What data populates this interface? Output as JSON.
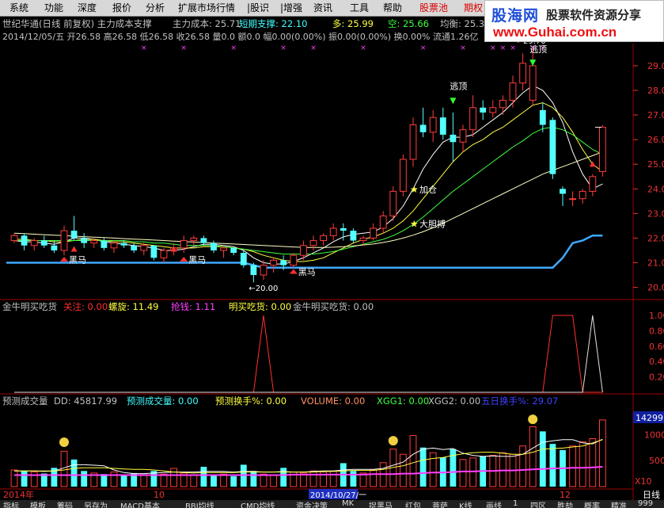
{
  "menu": {
    "items": [
      "系统",
      "功能",
      "深度",
      "报价",
      "分析",
      "扩展市场行情",
      "|股识",
      "|增强",
      "资讯",
      "工具",
      "帮助",
      "股票池",
      "期权"
    ],
    "red_items": [
      "股票池",
      "期权"
    ]
  },
  "brand": {
    "logo": "股海网",
    "slogan": "股票软件资源分享",
    "url": "www.Guhai.com.cn"
  },
  "header": {
    "title": "世纪华通(日线 前复权) 主力成本支撑",
    "cost_label": "主力成本: 25.71",
    "short_support": "短期支撑: 22.10",
    "long": "多: 25.99",
    "short": "空: 25.66",
    "avg": "均衡: 25.35",
    "ohlc": "2014/12/05/五 开26.58 高26.58 低26.58 收26.58 量0.0 额0.0 幅0.00(0.00%) 振0.00(0.00%) 换0.00% 流通1.26亿"
  },
  "annotations": {
    "top_price": "29.70",
    "escape1": "逃顶",
    "escape2": "逃顶",
    "add_position": "加仓",
    "bold_buy": "大胆搏",
    "dark_horse": "黑马",
    "low_price": "20.00"
  },
  "ind1": {
    "name": "金牛明买吃货",
    "items": [
      {
        "t": "关注: 0.00",
        "c": "#ff3030"
      },
      {
        "t": "螺旋: 11.49",
        "c": "#ffff40"
      },
      {
        "t": "抢钱: 1.11",
        "c": "#ff40ff"
      },
      {
        "t": "明买吃货: 0.00",
        "c": "#ffff40"
      },
      {
        "t": "金牛明买吃货: 0.00",
        "c": "#c0c0c0"
      }
    ],
    "axis": [
      "1.00",
      "0.80",
      "0.60",
      "0.40",
      "0.20"
    ]
  },
  "ind2": {
    "name": "预测成交量",
    "items": [
      {
        "t": "DD: 45817.99",
        "c": "#c0c0c0"
      },
      {
        "t": "预测成交量: 0.00",
        "c": "#40ffff"
      },
      {
        "t": "预测换手%: 0.00",
        "c": "#ffff40"
      },
      {
        "t": "VOLUME: 0.00",
        "c": "#ff9060"
      },
      {
        "t": "XGG1: 0.00",
        "c": "#40ff40"
      },
      {
        "t": "XGG2: 0.00",
        "c": "#c0c0c0"
      },
      {
        "t": "五日换手%: 29.07",
        "c": "#4040ff"
      }
    ],
    "axis": [
      "14299",
      "10000",
      "5000"
    ],
    "unit": "X10"
  },
  "date_axis": {
    "year": "2014年",
    "m1": "10",
    "cursor": "2014/10/27/一",
    "m2": "12",
    "period": "日线"
  },
  "bottom_tabs": [
    "指标",
    "模板",
    "筹码",
    "另存为",
    "MACD基本",
    "BBI均线",
    "CMD均线",
    "资金决策",
    "MK",
    "捉黑马",
    "红包",
    "菩萨",
    "K线",
    "画线",
    "1",
    "四区",
    "胜劫",
    "概率",
    "精准",
    "999",
    "???"
  ],
  "chart_data": {
    "type": "candlestick",
    "ylim": [
      19.6,
      29.9
    ],
    "yticks": [
      "29.00",
      "28.00",
      "27.00",
      "26.00",
      "25.00",
      "24.00",
      "23.00",
      "22.00",
      "21.00",
      "20.00"
    ],
    "candles": [
      [
        21.9,
        22.2,
        21.8,
        22.1
      ],
      [
        22.1,
        22.2,
        21.5,
        21.7
      ],
      [
        21.7,
        22.0,
        21.5,
        21.9
      ],
      [
        21.9,
        22.1,
        21.6,
        21.7
      ],
      [
        21.7,
        21.9,
        21.4,
        21.5
      ],
      [
        21.5,
        22.5,
        21.3,
        22.3
      ],
      [
        22.3,
        22.9,
        21.9,
        22.0
      ],
      [
        22.0,
        22.2,
        21.6,
        21.8
      ],
      [
        21.8,
        22.0,
        21.6,
        21.9
      ],
      [
        21.9,
        22.0,
        21.5,
        21.6
      ],
      [
        21.6,
        21.9,
        21.4,
        21.8
      ],
      [
        21.8,
        21.9,
        21.6,
        21.7
      ],
      [
        21.7,
        21.8,
        21.4,
        21.5
      ],
      [
        21.5,
        21.8,
        21.3,
        21.7
      ],
      [
        21.7,
        21.7,
        21.1,
        21.2
      ],
      [
        21.2,
        21.6,
        21.0,
        21.5
      ],
      [
        21.5,
        21.8,
        21.3,
        21.6
      ],
      [
        21.6,
        22.1,
        21.4,
        21.9
      ],
      [
        21.9,
        22.1,
        21.7,
        22.0
      ],
      [
        22.0,
        22.1,
        21.7,
        21.8
      ],
      [
        21.8,
        21.9,
        21.4,
        21.5
      ],
      [
        21.5,
        21.7,
        21.2,
        21.6
      ],
      [
        21.6,
        21.6,
        21.3,
        21.4
      ],
      [
        21.4,
        21.5,
        20.8,
        20.9
      ],
      [
        20.9,
        21.0,
        20.2,
        20.5
      ],
      [
        20.5,
        21.1,
        20.3,
        20.9
      ],
      [
        20.9,
        21.2,
        20.6,
        21.1
      ],
      [
        21.1,
        21.3,
        20.7,
        20.9
      ],
      [
        20.9,
        21.4,
        20.8,
        21.3
      ],
      [
        21.3,
        21.9,
        21.1,
        21.7
      ],
      [
        21.7,
        22.1,
        21.5,
        21.9
      ],
      [
        21.9,
        22.2,
        21.7,
        22.1
      ],
      [
        22.1,
        22.6,
        21.9,
        22.4
      ],
      [
        22.4,
        22.6,
        21.9,
        22.3
      ],
      [
        22.3,
        22.4,
        21.8,
        21.9
      ],
      [
        21.9,
        22.1,
        21.7,
        22.0
      ],
      [
        22.0,
        22.6,
        21.9,
        22.4
      ],
      [
        22.4,
        23.1,
        22.2,
        22.9
      ],
      [
        22.9,
        24.1,
        22.7,
        23.9
      ],
      [
        23.9,
        25.4,
        23.7,
        25.2
      ],
      [
        25.2,
        26.9,
        24.9,
        26.6
      ],
      [
        26.6,
        27.3,
        26.1,
        26.3
      ],
      [
        26.3,
        27.2,
        25.9,
        26.9
      ],
      [
        26.9,
        27.3,
        26.0,
        26.2
      ],
      [
        26.2,
        27.1,
        25.1,
        25.9
      ],
      [
        25.9,
        26.6,
        25.5,
        26.4
      ],
      [
        26.4,
        27.8,
        26.1,
        27.3
      ],
      [
        27.3,
        27.6,
        26.8,
        27.1
      ],
      [
        27.1,
        27.6,
        26.9,
        27.3
      ],
      [
        27.3,
        27.8,
        27.0,
        27.6
      ],
      [
        27.6,
        28.6,
        27.3,
        28.3
      ],
      [
        28.3,
        29.5,
        28.0,
        29.1
      ],
      [
        27.6,
        29.7,
        27.4,
        29.0
      ],
      [
        27.2,
        27.5,
        26.3,
        26.6
      ],
      [
        26.8,
        26.9,
        24.4,
        24.6
      ],
      [
        24.0,
        24.1,
        23.3,
        23.8
      ],
      [
        23.6,
        23.9,
        23.3,
        23.6
      ],
      [
        23.6,
        24.0,
        23.4,
        23.9
      ],
      [
        23.9,
        24.6,
        23.7,
        24.5
      ],
      [
        24.7,
        26.6,
        24.5,
        26.5
      ]
    ],
    "ma_lines": [
      {
        "name": "ma5",
        "color": "#ffffff",
        "values": [
          21.9,
          21.85,
          21.85,
          21.8,
          21.75,
          21.85,
          22.0,
          22.0,
          21.95,
          21.85,
          21.8,
          21.75,
          21.7,
          21.65,
          21.6,
          21.5,
          21.5,
          21.55,
          21.65,
          21.75,
          21.75,
          21.7,
          21.65,
          21.5,
          21.2,
          21.0,
          20.95,
          20.95,
          21.05,
          21.2,
          21.4,
          21.6,
          21.85,
          22.05,
          22.15,
          22.2,
          22.25,
          22.45,
          22.8,
          23.3,
          24.0,
          24.8,
          25.4,
          25.9,
          26.1,
          26.1,
          26.2,
          26.5,
          26.8,
          27.1,
          27.5,
          27.9,
          28.2,
          28.0,
          27.5,
          26.7,
          25.5,
          24.6,
          24.0,
          24.2
        ]
      },
      {
        "name": "ma10",
        "color": "#ffff40",
        "values": [
          21.95,
          21.95,
          21.9,
          21.9,
          21.85,
          21.85,
          21.9,
          21.95,
          21.95,
          21.9,
          21.85,
          21.85,
          21.8,
          21.75,
          21.7,
          21.65,
          21.6,
          21.6,
          21.6,
          21.65,
          21.65,
          21.65,
          21.6,
          21.55,
          21.45,
          21.3,
          21.2,
          21.1,
          21.05,
          21.05,
          21.1,
          21.2,
          21.4,
          21.6,
          21.8,
          21.95,
          22.05,
          22.2,
          22.4,
          22.7,
          23.1,
          23.6,
          24.1,
          24.6,
          25.1,
          25.5,
          25.8,
          26.0,
          26.3,
          26.5,
          26.8,
          27.1,
          27.4,
          27.5,
          27.3,
          26.9,
          26.3,
          25.6,
          25.0,
          24.7
        ]
      },
      {
        "name": "ma20",
        "color": "#40ff40",
        "values": [
          21.9,
          21.9,
          21.9,
          21.9,
          21.9,
          21.9,
          21.9,
          21.9,
          21.9,
          21.9,
          21.9,
          21.9,
          21.85,
          21.85,
          21.8,
          21.8,
          21.75,
          21.7,
          21.7,
          21.7,
          21.7,
          21.65,
          21.6,
          21.55,
          21.5,
          21.45,
          21.4,
          21.35,
          21.35,
          21.35,
          21.35,
          21.4,
          21.45,
          21.55,
          21.65,
          21.75,
          21.85,
          21.95,
          22.1,
          22.3,
          22.55,
          22.85,
          23.2,
          23.55,
          23.9,
          24.2,
          24.5,
          24.8,
          25.1,
          25.4,
          25.7,
          25.95,
          26.25,
          26.45,
          26.5,
          26.4,
          26.2,
          25.9,
          25.6,
          25.4
        ]
      },
      {
        "name": "ma60",
        "color": "#ffffc0",
        "values": [
          22.2,
          22.18,
          22.16,
          22.14,
          22.12,
          22.1,
          22.08,
          22.06,
          22.04,
          22.02,
          22.0,
          21.98,
          21.96,
          21.94,
          21.92,
          21.9,
          21.88,
          21.86,
          21.84,
          21.82,
          21.8,
          21.78,
          21.76,
          21.74,
          21.72,
          21.7,
          21.68,
          21.66,
          21.64,
          21.62,
          21.62,
          21.62,
          21.63,
          21.65,
          21.68,
          21.72,
          21.76,
          21.82,
          21.9,
          22.0,
          22.12,
          22.26,
          22.42,
          22.6,
          22.8,
          23.0,
          23.2,
          23.4,
          23.6,
          23.8,
          24.0,
          24.2,
          24.4,
          24.6,
          24.75,
          24.9,
          25.05,
          25.2,
          25.35,
          25.5
        ]
      }
    ],
    "support_line": {
      "color": "#40a8ff",
      "values": [
        21.0,
        21.0,
        21.0,
        21.0,
        21.0,
        21.0,
        21.0,
        21.0,
        21.0,
        21.0,
        21.0,
        21.0,
        21.0,
        21.0,
        21.0,
        21.0,
        21.0,
        21.0,
        21.0,
        21.0,
        21.0,
        21.0,
        21.0,
        21.0,
        20.9,
        20.8,
        20.8,
        20.8,
        20.8,
        20.8,
        20.8,
        20.8,
        20.8,
        20.8,
        20.8,
        20.8,
        20.8,
        20.8,
        20.8,
        20.8,
        20.8,
        20.8,
        20.8,
        20.8,
        20.8,
        20.8,
        20.8,
        20.8,
        20.8,
        20.8,
        20.8,
        20.8,
        20.8,
        20.8,
        20.8,
        21.2,
        21.8,
        21.9,
        22.1,
        22.1
      ]
    },
    "ind1_series": [
      {
        "name": "关注",
        "color": "#ff3030",
        "values": [
          0,
          0,
          0,
          0,
          0,
          0,
          0,
          0,
          0,
          0,
          0,
          0,
          0,
          0,
          0,
          0,
          0,
          0,
          0,
          0,
          0,
          0,
          0,
          0,
          0,
          1,
          0,
          0,
          0,
          0,
          0,
          0,
          0,
          0,
          0,
          0,
          0,
          0,
          0,
          0,
          0,
          0,
          0,
          0,
          0,
          0,
          0,
          0,
          0,
          0,
          0,
          0,
          0,
          0,
          1,
          1,
          1,
          0,
          0,
          0
        ]
      },
      {
        "name": "金牛明买吃货",
        "color": "#e0e0e0",
        "values": [
          0,
          0,
          0,
          0,
          0,
          0,
          0,
          0,
          0,
          0,
          0,
          0,
          0,
          0,
          0,
          0,
          0,
          0,
          0,
          0,
          0,
          0,
          0,
          0,
          0,
          0,
          0,
          0,
          0,
          0,
          0,
          0,
          0,
          0,
          0,
          0,
          0,
          0,
          0,
          0,
          0,
          0,
          0,
          0,
          0,
          0,
          0,
          0,
          0,
          0,
          0,
          0,
          0,
          0,
          0,
          0,
          0,
          0,
          1,
          0
        ]
      }
    ],
    "volume": [
      3.2,
      3.0,
      2.8,
      2.5,
      3.6,
      6.8,
      5.2,
      3.0,
      2.6,
      2.4,
      2.8,
      2.2,
      2.6,
      2.3,
      3.0,
      2.4,
      3.5,
      2.6,
      2.2,
      3.8,
      2.1,
      2.4,
      2.0,
      4.2,
      3.0,
      2.4,
      2.2,
      3.6,
      2.8,
      2.6,
      3.0,
      2.8,
      3.0,
      4.5,
      3.0,
      2.6,
      3.2,
      4.6,
      7.2,
      6.2,
      9.8,
      7.5,
      6.5,
      5.6,
      7.2,
      5.2,
      5.5,
      5.8,
      6.0,
      6.5,
      6.2,
      7.8,
      11.5,
      10.6,
      8.2,
      7.0,
      7.8,
      8.6,
      9.2,
      12.8
    ],
    "volume_ma": [
      {
        "name": "ma5",
        "color": "#ffffff",
        "values": [
          3.0,
          3.0,
          3.0,
          2.9,
          3.0,
          3.6,
          4.2,
          4.2,
          4.1,
          4.0,
          3.2,
          2.7,
          2.5,
          2.5,
          2.6,
          2.7,
          2.8,
          2.8,
          2.8,
          2.9,
          2.9,
          2.9,
          2.8,
          2.9,
          2.9,
          2.8,
          2.8,
          2.9,
          2.8,
          2.8,
          2.9,
          3.0,
          3.0,
          3.2,
          3.3,
          3.3,
          3.3,
          3.5,
          4.1,
          4.7,
          6.2,
          7.2,
          7.4,
          7.1,
          7.3,
          6.4,
          6.0,
          5.8,
          5.9,
          5.8,
          5.8,
          6.2,
          7.4,
          8.5,
          8.8,
          9.0,
          9.0,
          8.4,
          8.2,
          9.1
        ]
      },
      {
        "name": "ma10",
        "color": "#ffff40",
        "values": [
          3.0,
          3.0,
          3.0,
          3.0,
          3.0,
          3.2,
          3.5,
          3.6,
          3.6,
          3.6,
          3.5,
          3.4,
          3.3,
          3.3,
          3.2,
          3.0,
          2.8,
          2.7,
          2.6,
          2.7,
          2.7,
          2.7,
          2.7,
          2.8,
          2.8,
          2.8,
          2.8,
          2.8,
          2.8,
          2.8,
          2.8,
          2.9,
          2.9,
          3.0,
          3.1,
          3.1,
          3.1,
          3.3,
          3.7,
          4.0,
          4.6,
          5.1,
          5.4,
          5.6,
          6.0,
          6.3,
          6.5,
          6.6,
          6.6,
          6.4,
          6.2,
          6.2,
          6.6,
          7.2,
          7.3,
          7.4,
          7.6,
          7.8,
          8.4,
          9.0
        ]
      },
      {
        "name": "base",
        "color": "#ff40ff",
        "values": [
          2.2,
          2.2,
          2.2,
          2.2,
          2.2,
          2.2,
          2.2,
          2.2,
          2.2,
          2.2,
          2.2,
          2.2,
          2.2,
          2.2,
          2.2,
          2.2,
          2.2,
          2.2,
          2.2,
          2.2,
          2.2,
          2.2,
          2.2,
          2.2,
          2.2,
          2.2,
          2.2,
          2.2,
          2.3,
          2.3,
          2.3,
          2.3,
          2.3,
          2.3,
          2.3,
          2.3,
          2.4,
          2.4,
          2.4,
          2.5,
          2.5,
          2.6,
          2.7,
          2.7,
          2.8,
          2.9,
          2.9,
          3.0,
          3.0,
          3.1,
          3.1,
          3.2,
          3.3,
          3.4,
          3.5,
          3.5,
          3.6,
          3.6,
          3.7,
          3.8
        ]
      }
    ],
    "volume_ylim": [
      0,
      14.3
    ]
  }
}
